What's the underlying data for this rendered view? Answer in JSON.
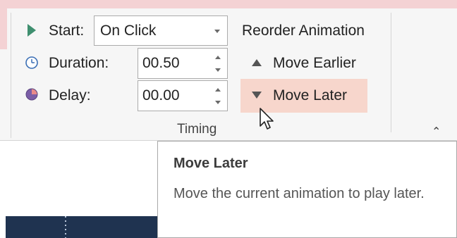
{
  "timing_group": {
    "start": {
      "label": "Start:",
      "value": "On Click"
    },
    "duration": {
      "label": "Duration:",
      "value": "00.50"
    },
    "delay": {
      "label": "Delay:",
      "value": "00.00"
    },
    "group_label": "Timing"
  },
  "reorder": {
    "header": "Reorder Animation",
    "move_earlier": "Move Earlier",
    "move_later": "Move Later"
  },
  "tooltip": {
    "title": "Move Later",
    "description": "Move the current animation to play later."
  },
  "colors": {
    "accent_pink": "#f4d2d4",
    "hover_highlight": "#f7d6cc",
    "play_icon": "#3f8f6f"
  },
  "icons": [
    "play-icon",
    "clock-icon",
    "delay-icon",
    "triangle-up-icon",
    "triangle-down-icon",
    "chevron-up-icon",
    "mouse-pointer-icon"
  ]
}
